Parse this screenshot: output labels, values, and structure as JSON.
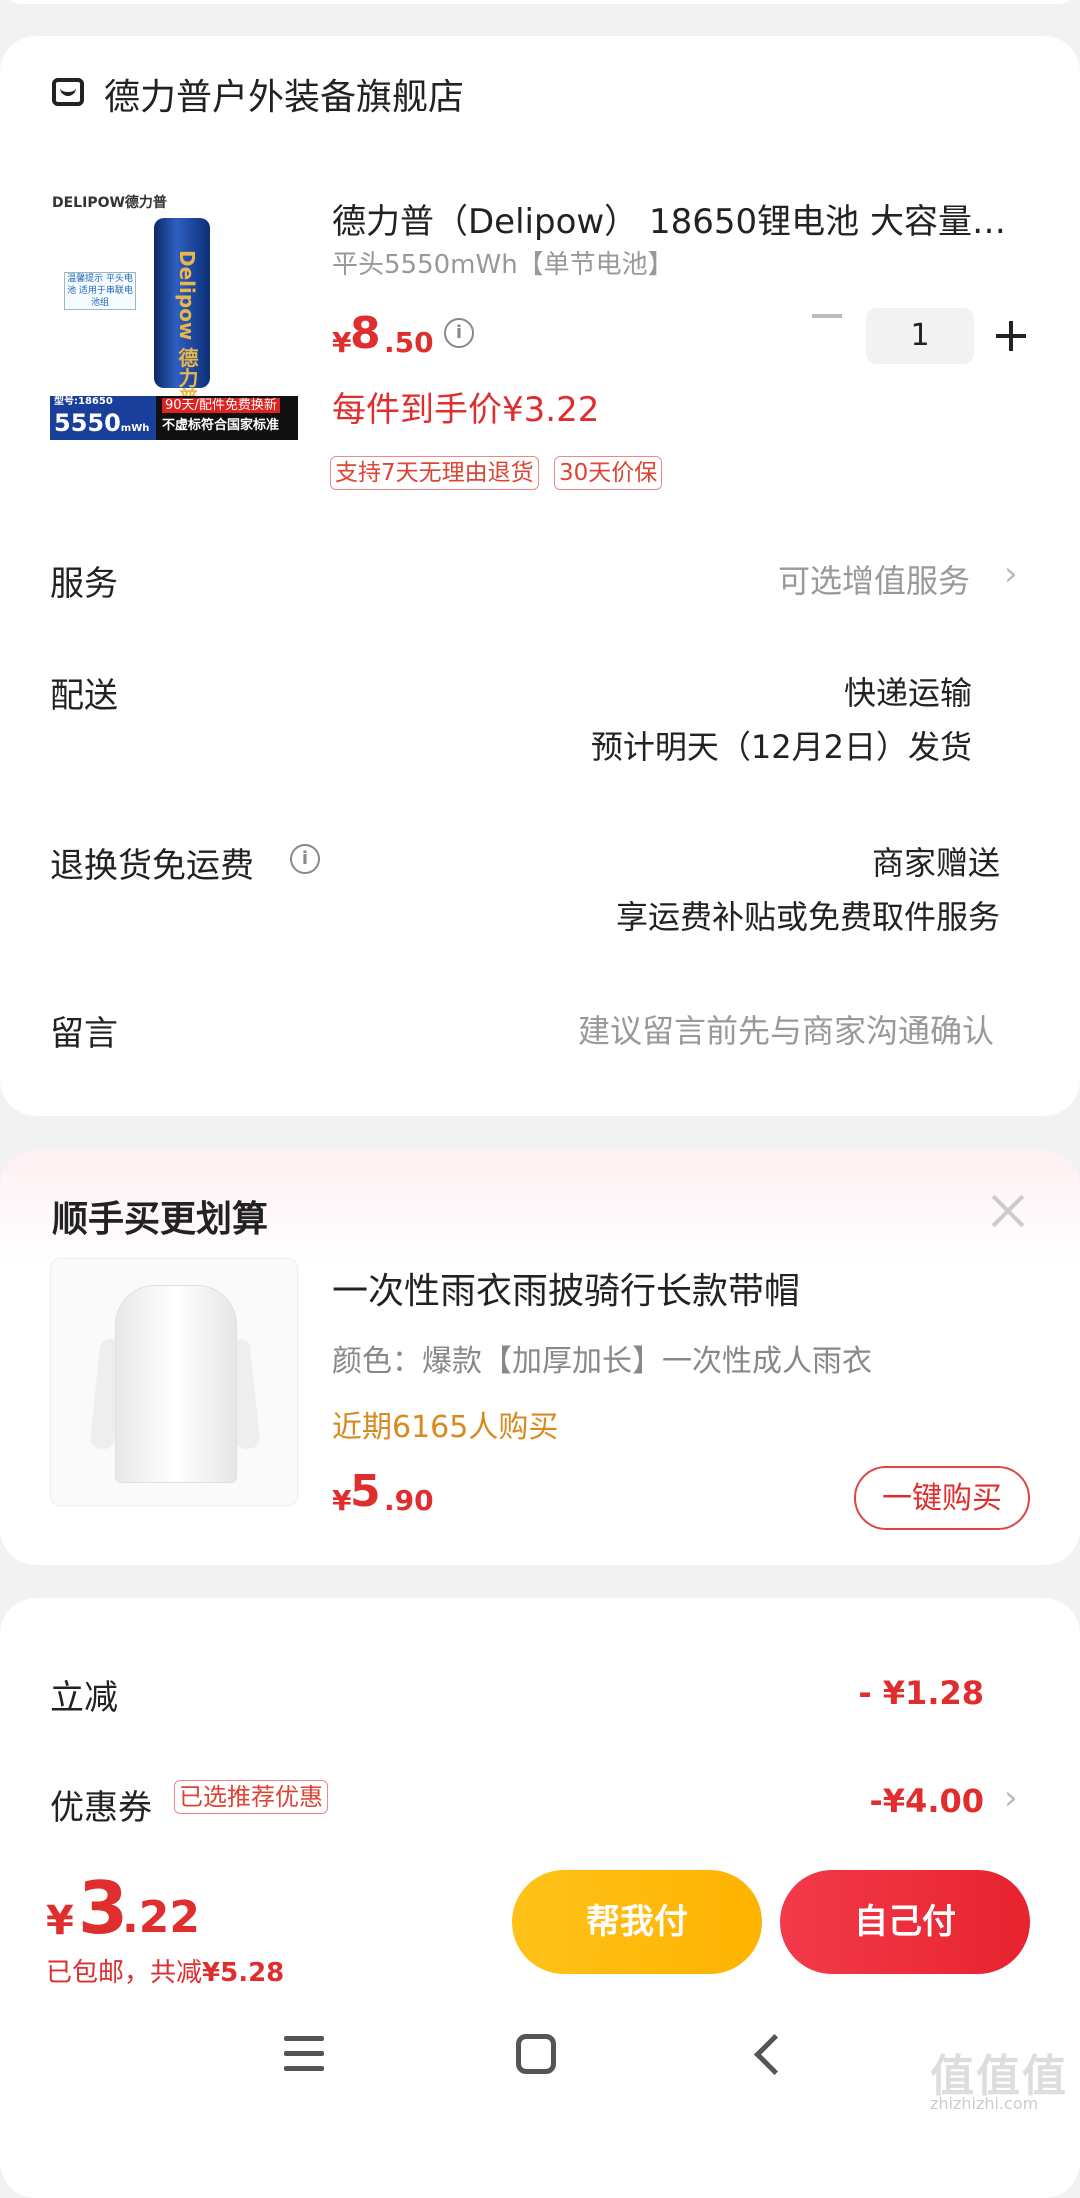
{
  "store": {
    "name": "德力普户外装备旗舰店",
    "icon": "store-icon"
  },
  "product": {
    "title": "德力普（Delipow） 18650锂电池 大容量…",
    "spec": "平头5550mWh【单节电池】",
    "price_symbol": "¥",
    "price_int": "8",
    "price_dec": ".50",
    "per_item_price": "每件到手价¥3.22",
    "quantity": "1",
    "badges": [
      "支持7天无理由退货",
      "30天价保"
    ],
    "image": {
      "brand": "DELIPOW德力普",
      "cell_text": "Delipow 德力普",
      "tag_text": "温馨提示 平头电池 适用于串联电池组",
      "model": "型号:18650",
      "capacity": "5550",
      "capacity_unit": "mWh",
      "promo1": "90天/配件免费换新",
      "promo2": "不虚标符合国家标准"
    }
  },
  "rows": {
    "service": {
      "label": "服务",
      "value": "可选增值服务"
    },
    "delivery": {
      "label": "配送",
      "value1": "快递运输",
      "value2": "预计明天（12月2日）发货"
    },
    "return_fee": {
      "label": "退换货免运费",
      "value1": "商家赠送",
      "value2": "享运费补贴或免费取件服务"
    },
    "message": {
      "label": "留言",
      "placeholder": "建议留言前先与商家沟通确认"
    }
  },
  "recommend": {
    "title": "顺手买更划算",
    "item_title": "一次性雨衣雨披骑行长款带帽",
    "item_spec": "颜色：爆款【加厚加长】一次性成人雨衣",
    "buyers": "近期6165人购买",
    "price_symbol": "¥",
    "price_int": "5",
    "price_dec": ".90",
    "buy_button": "一键购买"
  },
  "discounts": {
    "instant": {
      "label": "立减",
      "value": "- ¥1.28"
    },
    "coupon": {
      "label": "优惠券",
      "badge": "已选推荐优惠",
      "value": "-¥4.00"
    }
  },
  "footer": {
    "total_symbol": "¥",
    "total_int": "3",
    "total_dec": ".22",
    "note_prefix": "已包邮，共减",
    "note_amount": "¥5.28",
    "help_pay": "帮我付",
    "self_pay": "自己付"
  },
  "watermark": {
    "text": "值值值",
    "sub": "zhizhizhi.com"
  },
  "colors": {
    "accent": "#e02d2d",
    "help_btn": "#ffb300",
    "self_btn": "#e7232f",
    "buyers": "#d98a1f"
  }
}
